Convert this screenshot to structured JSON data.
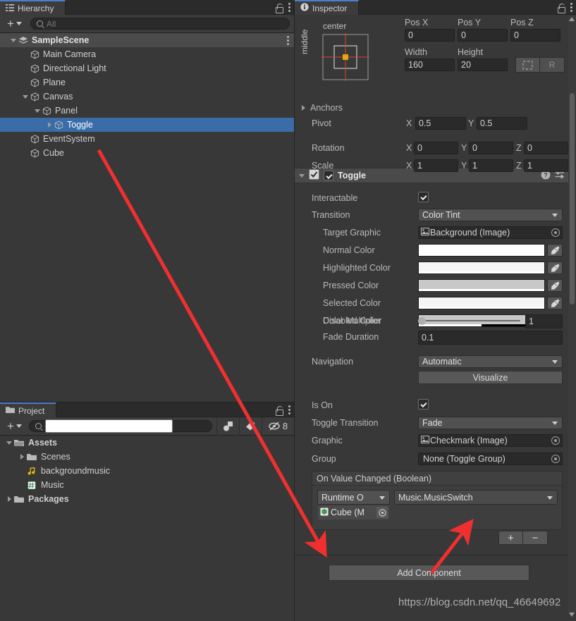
{
  "hierarchy": {
    "tab_label": "Hierarchy",
    "tab_icon": "hierarchy-icon",
    "lock_icon": "lock-icon",
    "menu_icon": "kebab-menu-icon",
    "add_label": "+",
    "search_placeholder": "All",
    "search_value": "",
    "tree": [
      {
        "label": "SampleScene",
        "depth": 0,
        "icon": "scene-icon",
        "expander": "down",
        "selected": false,
        "bold": true
      },
      {
        "label": "Main Camera",
        "depth": 1,
        "icon": "gameobject-icon",
        "expander": "none",
        "selected": false,
        "bold": false
      },
      {
        "label": "Directional Light",
        "depth": 1,
        "icon": "gameobject-icon",
        "expander": "none",
        "selected": false,
        "bold": false
      },
      {
        "label": "Plane",
        "depth": 1,
        "icon": "gameobject-icon",
        "expander": "none",
        "selected": false,
        "bold": false
      },
      {
        "label": "Canvas",
        "depth": 1,
        "icon": "gameobject-icon",
        "expander": "down",
        "selected": false,
        "bold": false
      },
      {
        "label": "Panel",
        "depth": 2,
        "icon": "gameobject-icon",
        "expander": "down",
        "selected": false,
        "bold": false
      },
      {
        "label": "Toggle",
        "depth": 3,
        "icon": "gameobject-icon",
        "expander": "right",
        "selected": true,
        "bold": false
      },
      {
        "label": "EventSystem",
        "depth": 1,
        "icon": "gameobject-icon",
        "expander": "none",
        "selected": false,
        "bold": false
      },
      {
        "label": "Cube",
        "depth": 1,
        "icon": "gameobject-icon",
        "expander": "none",
        "selected": false,
        "bold": false
      }
    ]
  },
  "project": {
    "tab_label": "Project",
    "tab_icon": "folder-icon",
    "lock_icon": "lock-icon",
    "menu_icon": "kebab-menu-icon",
    "add_label": "+",
    "search_placeholder": "",
    "search_value": "",
    "toolbar_icons": [
      "package-filter-icon",
      "label-filter-icon",
      "hidden-packages-icon"
    ],
    "hidden_count": "8",
    "tree": [
      {
        "label": "Assets",
        "depth": 0,
        "icon": "folder-open-icon",
        "expander": "down",
        "bold": true
      },
      {
        "label": "Scenes",
        "depth": 1,
        "icon": "folder-icon",
        "expander": "right",
        "bold": false
      },
      {
        "label": "backgroundmusic",
        "depth": 1,
        "icon": "audio-clip-icon",
        "expander": "none",
        "bold": false
      },
      {
        "label": "Music",
        "depth": 1,
        "icon": "csharp-script-icon",
        "expander": "none",
        "bold": false
      },
      {
        "label": "Packages",
        "depth": 0,
        "icon": "folder-icon",
        "expander": "right",
        "bold": true
      }
    ]
  },
  "inspector": {
    "tab_label": "Inspector",
    "tab_icon": "info-icon",
    "lock_icon": "lock-icon",
    "menu_icon": "kebab-menu-icon",
    "rect_transform": {
      "anchor_preset_top": "center",
      "anchor_preset_left": "middle",
      "pos_labels": [
        "Pos X",
        "Pos Y",
        "Pos Z"
      ],
      "pos_values": [
        "0",
        "0",
        "0"
      ],
      "size_labels": [
        "Width",
        "Height"
      ],
      "size_values": [
        "160",
        "20"
      ],
      "blueprint_icon": "blueprint-mode-icon",
      "raw_label": "R",
      "anchors_label": "Anchors",
      "anchors_expander": "right",
      "pivot_label": "Pivot",
      "pivot_axes": [
        "X",
        "Y"
      ],
      "pivot_values": [
        "0.5",
        "0.5"
      ],
      "rotation_label": "Rotation",
      "rotation_axes": [
        "X",
        "Y",
        "Z"
      ],
      "rotation_values": [
        "0",
        "0",
        "0"
      ],
      "scale_label": "Scale",
      "scale_axes": [
        "X",
        "Y",
        "Z"
      ],
      "scale_values": [
        "1",
        "1",
        "1"
      ]
    },
    "toggle_component": {
      "title": "Toggle",
      "enabled": true,
      "expander": "down",
      "header_icons": [
        "help-icon",
        "preset-icon",
        "kebab-menu-icon"
      ],
      "interactable_label": "Interactable",
      "interactable_value": true,
      "transition_label": "Transition",
      "transition_value": "Color Tint",
      "target_graphic_label": "Target Graphic",
      "target_graphic_value": "Background (Image)",
      "colors": [
        {
          "label": "Normal Color",
          "hex": "#ffffff",
          "alpha": 1.0
        },
        {
          "label": "Highlighted Color",
          "hex": "#f5f5f5",
          "alpha": 1.0
        },
        {
          "label": "Pressed Color",
          "hex": "#c8c8c8",
          "alpha": 1.0
        },
        {
          "label": "Selected Color",
          "hex": "#f5f5f5",
          "alpha": 1.0
        },
        {
          "label": "Disabled Color",
          "hex": "#c8c8c8",
          "alpha": 0.5
        }
      ],
      "color_multiplier_label": "Color Multiplier",
      "color_multiplier_value": "1",
      "color_multiplier_fraction": 0.0,
      "fade_duration_label": "Fade Duration",
      "fade_duration_value": "0.1",
      "navigation_label": "Navigation",
      "navigation_value": "Automatic",
      "visualize_label": "Visualize",
      "is_on_label": "Is On",
      "is_on_value": true,
      "toggle_transition_label": "Toggle Transition",
      "toggle_transition_value": "Fade",
      "graphic_label": "Graphic",
      "graphic_value": "Checkmark (Image)",
      "group_label": "Group",
      "group_value": "None (Toggle Group)",
      "event": {
        "header": "On Value Changed (Boolean)",
        "runtime_mode": "Runtime O",
        "function": "Music.MusicSwitch",
        "object_value": "Cube (M",
        "add_label": "+",
        "remove_label": "−"
      }
    },
    "add_component_label": "Add Component"
  },
  "watermark": "https://blog.csdn.net/qq_46649692",
  "annotations": {
    "arrows": [
      {
        "name": "arrow-hierarchy-to-object-field",
        "color": "#f03030"
      },
      {
        "name": "arrow-to-function-dropdown",
        "color": "#f03030"
      }
    ]
  },
  "colors": {
    "selection_blue": "#3a6da8",
    "tab_accent": "#4b7ecb",
    "panel_bg": "#383838",
    "annotation_red": "#f03030"
  }
}
